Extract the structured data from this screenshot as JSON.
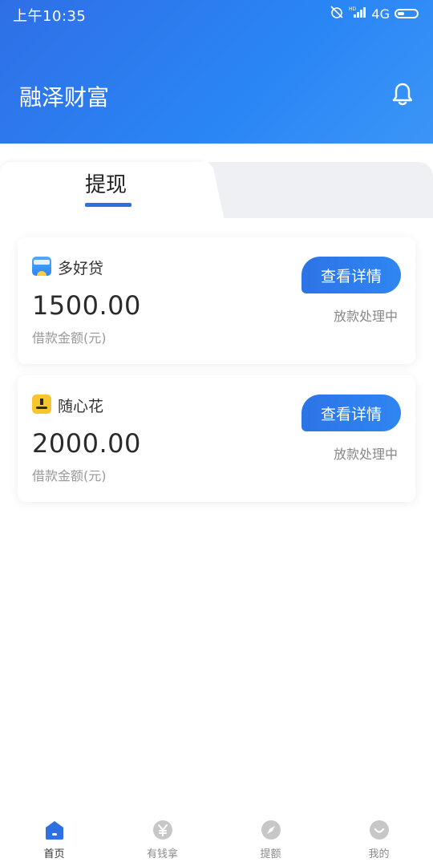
{
  "status_bar": {
    "time": "上午10:35",
    "network": "4G",
    "hd": "HD"
  },
  "header": {
    "title": "融泽财富"
  },
  "tabs": [
    {
      "label": "提现",
      "active": true
    }
  ],
  "loans": [
    {
      "product": "多好贷",
      "amount": "1500.00",
      "amount_label": "借款金额(元)",
      "button": "查看详情",
      "status": "放款处理中"
    },
    {
      "product": "随心花",
      "amount": "2000.00",
      "amount_label": "借款金额(元)",
      "button": "查看详情",
      "status": "放款处理中"
    }
  ],
  "bottom_nav": [
    {
      "label": "首页",
      "icon": "home-icon",
      "active": true
    },
    {
      "label": "有钱拿",
      "icon": "yuan-icon",
      "active": false
    },
    {
      "label": "提额",
      "icon": "compass-icon",
      "active": false
    },
    {
      "label": "我的",
      "icon": "smile-icon",
      "active": false
    }
  ],
  "colors": {
    "primary": "#2e6fe1",
    "header_start": "#2f6fe6",
    "header_end": "#3b95f7",
    "inactive_icon": "#c7c7c7"
  }
}
